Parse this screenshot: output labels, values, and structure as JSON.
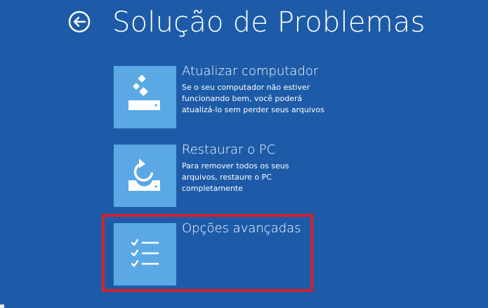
{
  "header": {
    "title": "Solução de Problemas",
    "back_icon": "back-arrow-circle-icon"
  },
  "options": [
    {
      "title": "Atualizar computador",
      "description": "Se o seu computador não estiver funcionando bem, você poderá atualizá-lo sem perder seus arquivos",
      "icon": "refresh-pc-icon"
    },
    {
      "title": "Restaurar o PC",
      "description": "Para remover todos os seus arquivos, restaure o PC completamente",
      "icon": "reset-pc-icon"
    },
    {
      "title": "Opções avançadas",
      "description": "",
      "icon": "checklist-icon",
      "highlighted": true
    }
  ],
  "colors": {
    "background": "#1d5ba8",
    "tile": "#5aa8e4",
    "text": "#ffffff",
    "highlight": "#d8202d"
  }
}
